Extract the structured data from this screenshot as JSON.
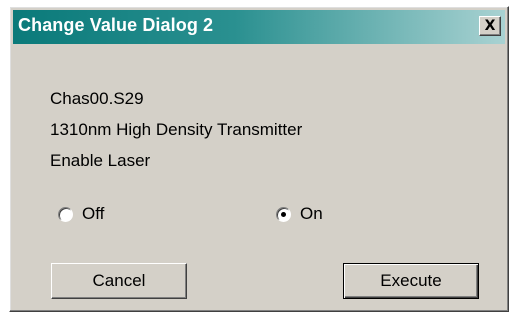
{
  "window": {
    "title": "Change Value Dialog 2",
    "close_label": "X"
  },
  "info": {
    "chassis": "Chas00.S29",
    "device": "1310nm High Density Transmitter",
    "setting": "Enable Laser"
  },
  "options": [
    {
      "label": "Off",
      "selected": false
    },
    {
      "label": "On",
      "selected": true
    }
  ],
  "buttons": {
    "cancel_label": "Cancel",
    "execute_label": "Execute"
  },
  "colors": {
    "titlebar_start": "#0a7a7a",
    "titlebar_end": "#a9d2d2",
    "dialog_background": "#d4d0c8"
  }
}
